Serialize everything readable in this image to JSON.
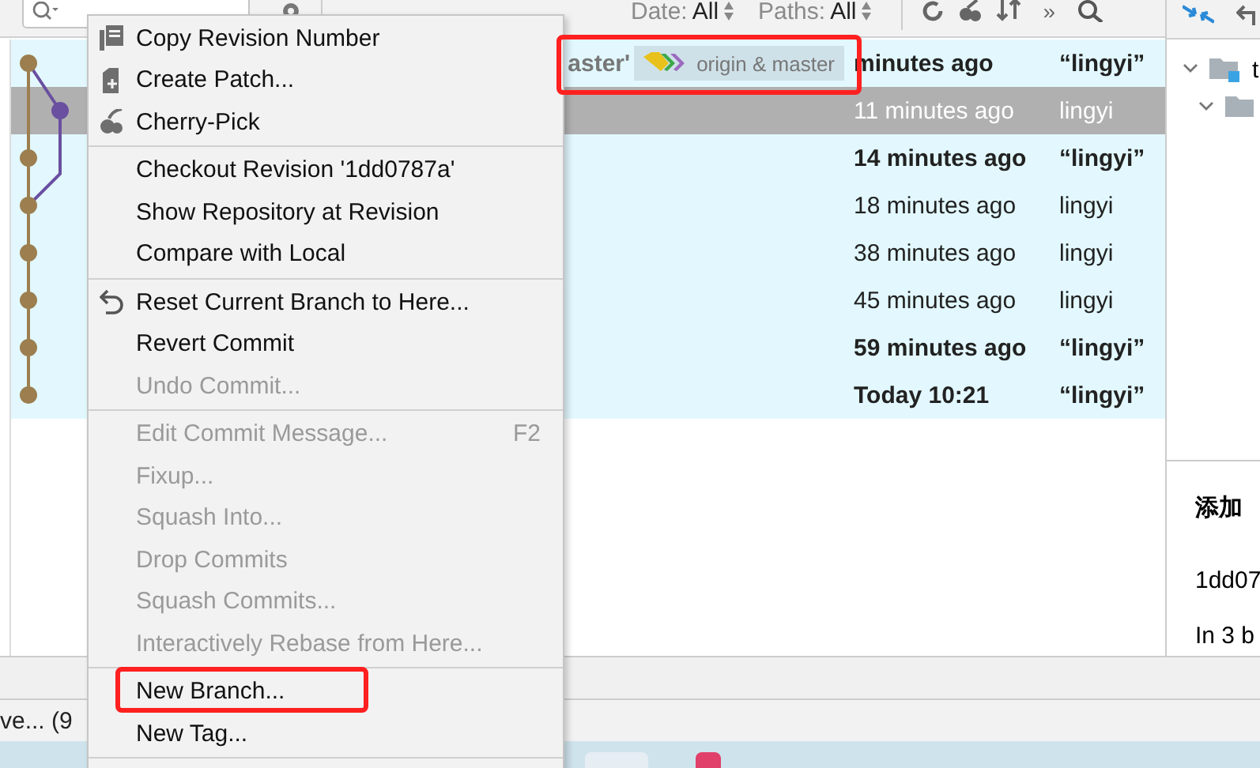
{
  "toolbar": {
    "filters": [
      {
        "label": "Date:",
        "value": "All"
      },
      {
        "label": "Paths:",
        "value": "All"
      }
    ],
    "more": "»"
  },
  "commits": [
    {
      "message_tail": "aster'",
      "tag": {
        "label": "origin & master",
        "highlighted": true
      },
      "date": "minutes ago",
      "author": "“lingyi”",
      "bold": true,
      "selected": false
    },
    {
      "date": "11 minutes ago",
      "author": "lingyi",
      "bold": false,
      "selected": true
    },
    {
      "date": "14 minutes ago",
      "author": "“lingyi”",
      "bold": true,
      "selected": false
    },
    {
      "date": "18 minutes ago",
      "author": "lingyi",
      "bold": false,
      "selected": false
    },
    {
      "date": "38 minutes ago",
      "author": "lingyi",
      "bold": false,
      "selected": false
    },
    {
      "date": "45 minutes ago",
      "author": "lingyi",
      "bold": false,
      "selected": false
    },
    {
      "date": "59 minutes ago",
      "author": "“lingyi”",
      "bold": true,
      "selected": false
    },
    {
      "date": "Today 10:21",
      "author": "“lingyi”",
      "bold": true,
      "selected": false
    }
  ],
  "context_menu": {
    "items": [
      {
        "kind": "item",
        "label": "Copy Revision Number",
        "disabled": false,
        "highlighted": false
      },
      {
        "kind": "item",
        "label": "Create Patch...",
        "disabled": false,
        "highlighted": false
      },
      {
        "kind": "item",
        "label": "Cherry-Pick",
        "disabled": false,
        "highlighted": false
      },
      {
        "kind": "separator"
      },
      {
        "kind": "item",
        "label": "Checkout Revision '1dd0787a'",
        "disabled": false,
        "highlighted": false
      },
      {
        "kind": "item",
        "label": "Show Repository at Revision",
        "disabled": false,
        "highlighted": false
      },
      {
        "kind": "item",
        "label": "Compare with Local",
        "disabled": false,
        "highlighted": false
      },
      {
        "kind": "separator"
      },
      {
        "kind": "item",
        "label": "Reset Current Branch to Here...",
        "disabled": false,
        "highlighted": false
      },
      {
        "kind": "item",
        "label": "Revert Commit",
        "disabled": false,
        "highlighted": false
      },
      {
        "kind": "item",
        "label": "Undo Commit...",
        "disabled": true,
        "highlighted": false
      },
      {
        "kind": "separator"
      },
      {
        "kind": "item",
        "label": "Edit Commit Message...",
        "shortcut": "F2",
        "disabled": true,
        "highlighted": false
      },
      {
        "kind": "item",
        "label": "Fixup...",
        "disabled": true,
        "highlighted": false
      },
      {
        "kind": "item",
        "label": "Squash Into...",
        "disabled": true,
        "highlighted": false
      },
      {
        "kind": "item",
        "label": "Drop Commits",
        "disabled": true,
        "highlighted": false
      },
      {
        "kind": "item",
        "label": "Squash Commits...",
        "disabled": true,
        "highlighted": false
      },
      {
        "kind": "item",
        "label": "Interactively Rebase from Here...",
        "disabled": true,
        "highlighted": false
      },
      {
        "kind": "separator"
      },
      {
        "kind": "item",
        "label": "New Branch...",
        "disabled": false,
        "highlighted": true
      },
      {
        "kind": "item",
        "label": "New Tag...",
        "disabled": false,
        "highlighted": false
      },
      {
        "kind": "separator"
      }
    ]
  },
  "details_panel": {
    "tree": [
      {
        "label": "t",
        "expanded": true,
        "children": [
          {
            "expanded": true
          }
        ]
      }
    ],
    "commit_title": "添加",
    "hash": "1dd07",
    "branches_note": "In 3 b"
  },
  "status_text": "ve... (9"
}
